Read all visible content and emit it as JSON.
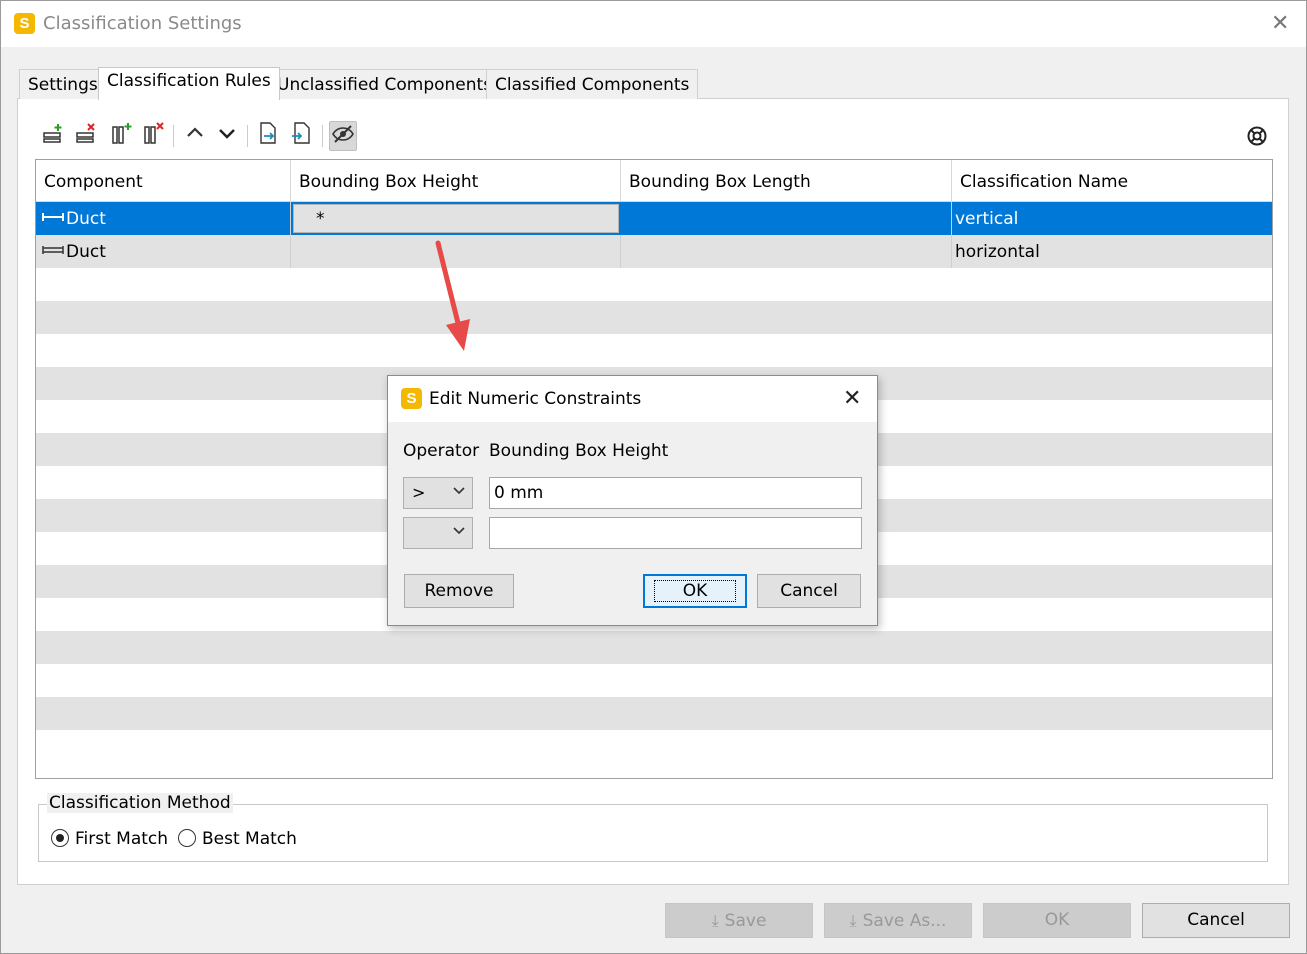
{
  "window": {
    "title": "Classification Settings",
    "app_icon_letter": "S"
  },
  "tabs": [
    {
      "label": "Settings"
    },
    {
      "label": "Classification Rules"
    },
    {
      "label": "Unclassified Components"
    },
    {
      "label": "Classified Components"
    }
  ],
  "toolbar": {
    "icons": [
      "add-row-icon",
      "remove-row-icon",
      "add-column-icon",
      "remove-column-icon",
      "move-up-icon",
      "move-down-icon",
      "export-icon",
      "import-icon",
      "hide-eye-icon",
      "help-icon"
    ]
  },
  "grid": {
    "columns": [
      "Component",
      "Bounding Box Height",
      "Bounding Box Length",
      "Classification Name"
    ],
    "rows": [
      {
        "component": "Duct",
        "height": "*",
        "length": "",
        "name": "vertical"
      },
      {
        "component": "Duct",
        "height": "",
        "length": "",
        "name": "horizontal"
      }
    ]
  },
  "dialog": {
    "title": "Edit Numeric Constraints",
    "operator_label": "Operator",
    "field_label": "Bounding Box Height",
    "operator1": ">",
    "value1": "0 mm",
    "operator2": "",
    "value2": "",
    "remove_label": "Remove",
    "ok_label": "OK",
    "cancel_label": "Cancel"
  },
  "classification_method": {
    "legend": "Classification Method",
    "options": [
      "First Match",
      "Best Match"
    ],
    "selected": "First Match"
  },
  "footer": {
    "save_label": "Save",
    "save_as_label": "Save As...",
    "ok_label": "OK",
    "cancel_label": "Cancel"
  },
  "colors": {
    "selection": "#0078d7",
    "app_icon": "#f5b800",
    "arrow": "#e84a4a"
  }
}
